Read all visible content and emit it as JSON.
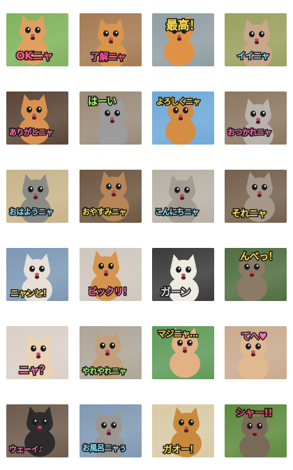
{
  "stickers": [
    {
      "caption": "OKニャ",
      "caption_color": "#ff5c8a",
      "bg": "#7fb35c",
      "cat": "#e0a060"
    },
    {
      "caption": "了解ニャ",
      "caption_color": "#ff4fa0",
      "bg": "#a57a52",
      "cat": "#d9954a"
    },
    {
      "caption": "最高！",
      "caption_color": "#ffe14a",
      "bg": "#8f9ea4",
      "cat": "#df9244"
    },
    {
      "caption": "イイニャ",
      "caption_color": "#8fe3ff",
      "bg": "#9aa05e",
      "cat": "#c9a78a"
    },
    {
      "caption": "ありがとニャ",
      "caption_color": "#ff6fb0",
      "bg": "#5a4436",
      "cat": "#d99350"
    },
    {
      "caption": "はーい",
      "caption_color": "#a8ff6a",
      "bg": "#9a8a78",
      "cat": "#9c9c9c"
    },
    {
      "caption": "よろしくニャ",
      "caption_color": "#ffe14a",
      "bg": "#6ea9d8",
      "cat": "#d38e44"
    },
    {
      "caption": "おつかれニャ",
      "caption_color": "#ff6fb0",
      "bg": "#8c7760",
      "cat": "#b9b3ad"
    },
    {
      "caption": "おはようニャ",
      "caption_color": "#8fe3ff",
      "bg": "#c8b48a",
      "cat": "#8b8b86"
    },
    {
      "caption": "おやすみニャ",
      "caption_color": "#ffe14a",
      "bg": "#6e5640",
      "cat": "#b78556"
    },
    {
      "caption": "こんにちニャ",
      "caption_color": "#8fe3ff",
      "bg": "#b7b0a4",
      "cat": "#a39c94"
    },
    {
      "caption": "それニャ",
      "caption_color": "#ffe14a",
      "bg": "#75604c",
      "cat": "#a6998c"
    },
    {
      "caption": "ニャンと！",
      "caption_color": "#ffe14a",
      "bg": "#7d98b5",
      "cat": "#e6e0d8"
    },
    {
      "caption": "ビックリ！",
      "caption_color": "#ff6fb0",
      "bg": "#cfc6bc",
      "cat": "#d6954e"
    },
    {
      "caption": "ガーン",
      "caption_color": "#d8d8d8",
      "bg": "#3a3a3a",
      "cat": "#efeae2"
    },
    {
      "caption": "んべっ！",
      "caption_color": "#ffe14a",
      "bg": "#4f6e3f",
      "cat": "#8a7a66"
    },
    {
      "caption": "ニャ？",
      "caption_color": "#ff6fb0",
      "bg": "#d9cfc6",
      "cat": "#e9d2b5"
    },
    {
      "caption": "やれやれニャ",
      "caption_color": "#a8ff6a",
      "bg": "#ada597",
      "cat": "#c2a07c"
    },
    {
      "caption": "マジニャ…",
      "caption_color": "#ffe14a",
      "bg": "#5f9a58",
      "cat": "#e2b184"
    },
    {
      "caption": "てへ♥",
      "caption_color": "#ff6fb0",
      "bg": "#c9aa8e",
      "cat": "#e0b98f"
    },
    {
      "caption": "ウェーイ♪",
      "caption_color": "#ff6fb0",
      "bg": "#6d5a4a",
      "cat": "#2c2c2c"
    },
    {
      "caption": "お風呂ニャぅ",
      "caption_color": "#8fe3ff",
      "bg": "#7f99b3",
      "cat": "#9b9690"
    },
    {
      "caption": "ガオー！",
      "caption_color": "#ffe14a",
      "bg": "#d9c9a4",
      "cat": "#c98a3e"
    },
    {
      "caption": "シャー!!",
      "caption_color": "#ff4f70",
      "bg": "#5d8a3c",
      "cat": "#7a6a58"
    }
  ]
}
